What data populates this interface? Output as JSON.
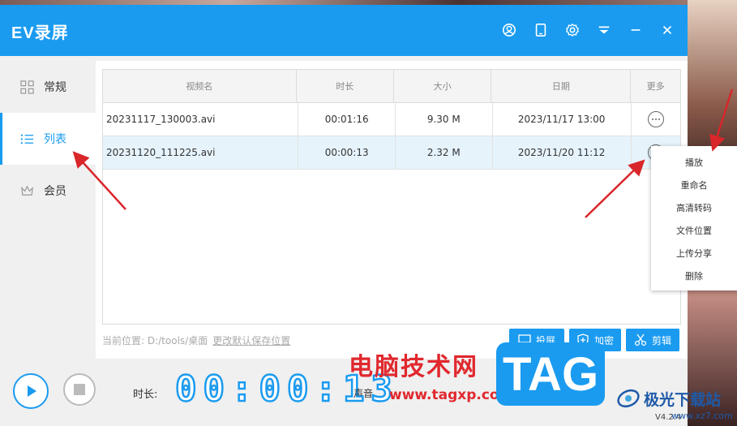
{
  "app": {
    "title": "EV录屏",
    "version": "V4.2.4"
  },
  "titlebar_icons": [
    "user-icon",
    "tablet-icon",
    "settings-icon",
    "dropdown-icon",
    "minimize-icon",
    "close-icon"
  ],
  "sidebar": {
    "items": [
      {
        "label": "常规",
        "icon": "grid-icon",
        "active": false
      },
      {
        "label": "列表",
        "icon": "list-icon",
        "active": true
      },
      {
        "label": "会员",
        "icon": "crown-icon",
        "active": false
      }
    ]
  },
  "table": {
    "headers": [
      "视频名",
      "时长",
      "大小",
      "日期",
      "更多"
    ],
    "rows": [
      {
        "name": "20231117_130003.avi",
        "duration": "00:01:16",
        "size": "9.30 M",
        "date": "2023/11/17 13:00",
        "selected": false
      },
      {
        "name": "20231120_111225.avi",
        "duration": "00:00:13",
        "size": "2.32 M",
        "date": "2023/11/20 11:12",
        "selected": true
      }
    ]
  },
  "path": {
    "label": "当前位置: D:/tools/桌面",
    "change_link": "更改默认保存位置"
  },
  "actions": {
    "cast": "投屏",
    "encrypt": "加密",
    "edit": "剪辑"
  },
  "bottom": {
    "duration_label": "时长:",
    "timer": "00:00:13",
    "volume_label": "声音"
  },
  "context_menu": [
    "播放",
    "重命名",
    "高清转码",
    "文件位置",
    "上传分享",
    "删除"
  ],
  "watermark": {
    "text": "电脑技术网",
    "url": "www.tagxp.com",
    "tag": "TAG",
    "site": "极光下载站",
    "site_url": "www.xz7.com"
  },
  "colors": {
    "accent": "#1a9bf0",
    "selected_row": "#e6f3fb",
    "arrow": "#d9262b",
    "watermark_red": "#e0282e"
  }
}
